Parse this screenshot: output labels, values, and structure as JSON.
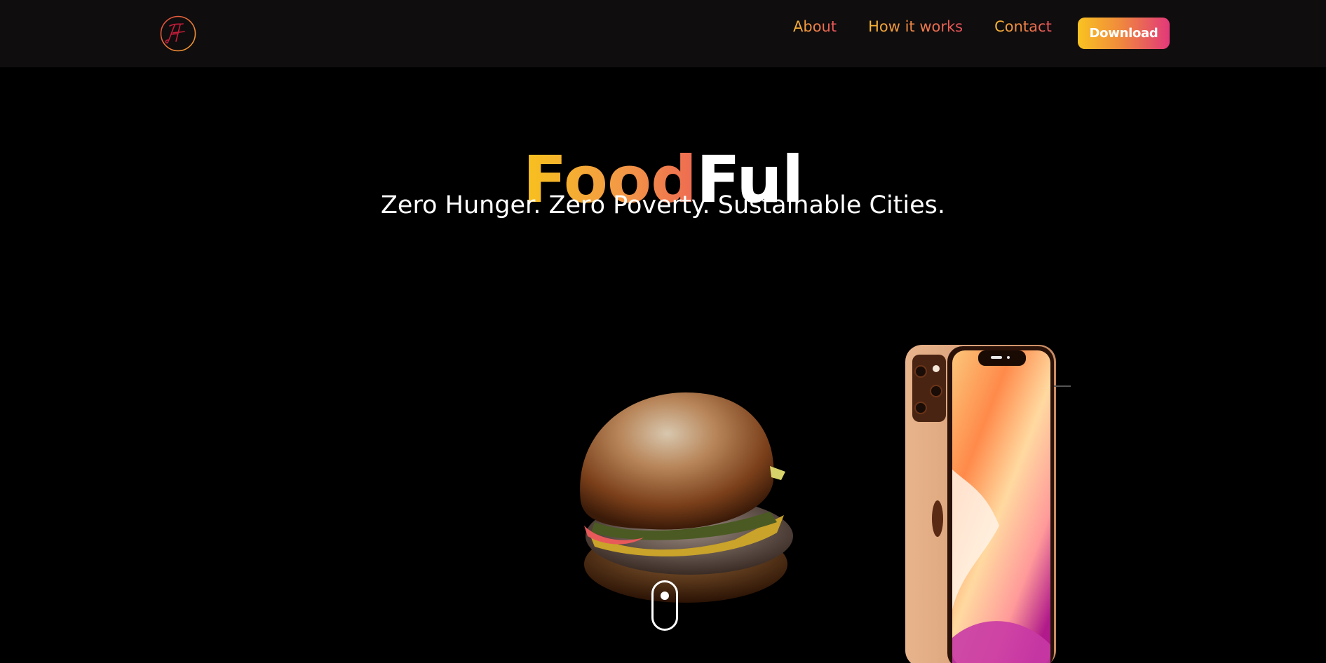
{
  "nav": {
    "logo_alt": "FF",
    "links": [
      {
        "label": "About"
      },
      {
        "label": "How it works"
      },
      {
        "label": "Contact"
      }
    ],
    "download_label": "Download"
  },
  "hero": {
    "title_part1": "Food",
    "title_part2": "Ful",
    "tagline": "Zero Hunger. Zero Poverty. Sustainable Cities."
  },
  "colors": {
    "gradient_start": "#f8c21d",
    "gradient_mid": "#f39a45",
    "gradient_end": "#e2387a",
    "background": "#000000",
    "navbar": "#0f0d0e"
  },
  "icons": {
    "logo": "ff-monogram-icon",
    "scroll": "mouse-scroll-icon"
  }
}
